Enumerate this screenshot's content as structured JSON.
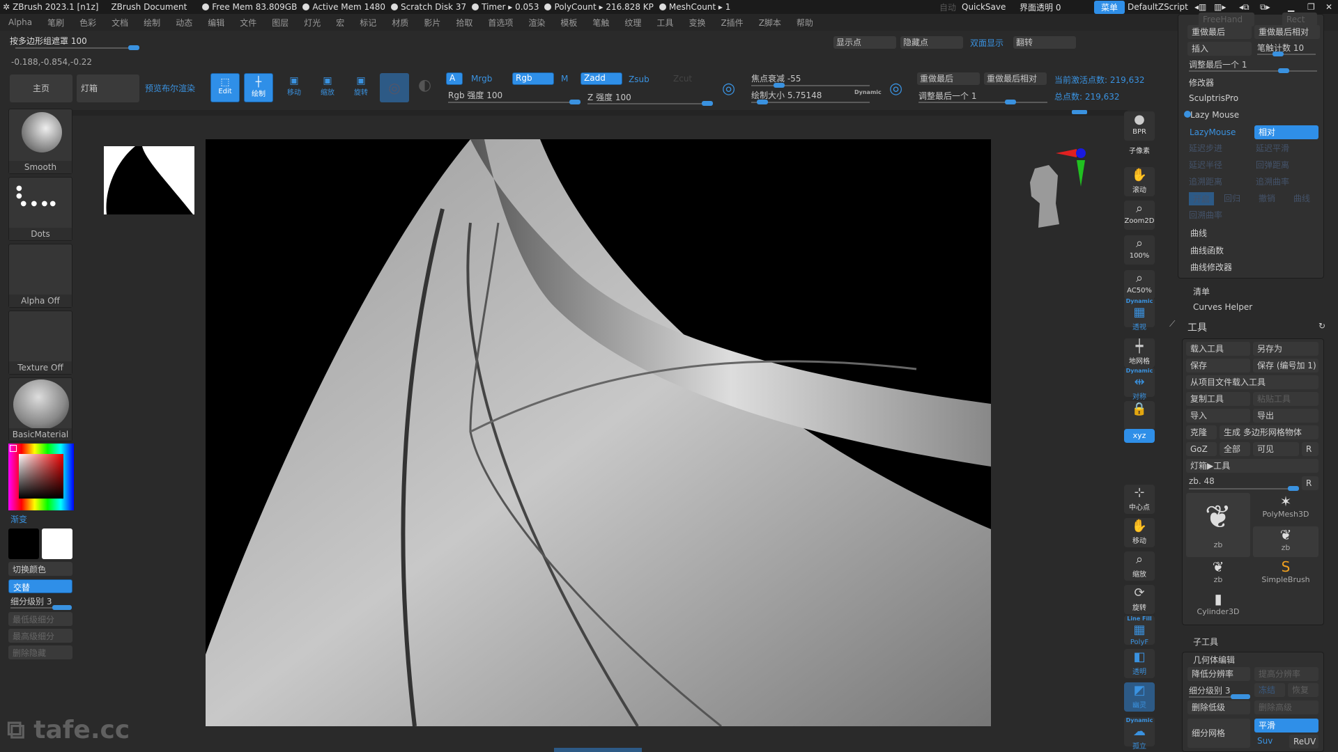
{
  "titlebar": {
    "app": "ZBrush 2023.1 [n1z]",
    "document": "ZBrush Document",
    "stats": [
      {
        "label": "Free Mem 83.809GB"
      },
      {
        "label": "Active Mem 1480"
      },
      {
        "label": "Scratch Disk 37"
      },
      {
        "label": "Timer ▸ 0.053"
      },
      {
        "label": "PolyCount ▸ 216.828 KP"
      },
      {
        "label": "MeshCount ▸ 1"
      }
    ],
    "auto": "自动",
    "quicksave": "QuickSave",
    "ui_transparency": "界面透明 0",
    "menu_button": "菜单",
    "script": "DefaultZScript"
  },
  "menubar": [
    "Alpha",
    "笔刷",
    "色彩",
    "文档",
    "绘制",
    "动态",
    "编辑",
    "文件",
    "图层",
    "灯光",
    "宏",
    "标记",
    "材质",
    "影片",
    "拾取",
    "首选项",
    "渲染",
    "模板",
    "笔触",
    "纹理",
    "工具",
    "变换",
    "Z插件",
    "Z脚本",
    "帮助"
  ],
  "top_left": {
    "polygroup_mask": "按多边形组遮罩 100",
    "coords": "-0.188,-0.854,-0.22",
    "home": "主页",
    "lightbox": "灯箱",
    "bool_preview": "预览布尔渲染"
  },
  "toolbar": {
    "edit": "Edit",
    "draw": "绘制",
    "move": "移动",
    "scale": "缩放",
    "rotate": "旋转",
    "a": "A",
    "mrgb": "Mrgb",
    "rgb": "Rgb",
    "m": "M",
    "zadd": "Zadd",
    "zsub": "Zsub",
    "zcut": "Zcut",
    "rgb_intensity": "Rgb 强度 100",
    "z_intensity": "Z 强度 100",
    "focal_shift": "焦点衰减 -55",
    "draw_size": "绘制大小 5.75148",
    "dynamic": "Dynamic",
    "redo_last": "重做最后",
    "redo_last_rel": "重做最后相对",
    "adjust_last": "调整最后一个 1",
    "active_points": "当前激活点数: 219,632",
    "total_points": "总点数: 219,632",
    "show_pts": "显示点",
    "hide_pts": "隐藏点",
    "double_sided": "双面显示",
    "flip": "翻转"
  },
  "left_panel": {
    "brush": "Smooth",
    "stroke": "Dots",
    "alpha": "Alpha Off",
    "texture": "Texture Off",
    "material": "BasicMaterial",
    "gradient": "渐变",
    "switch_color": "切换颜色",
    "alternate": "交替",
    "subdiv": "细分级别 3",
    "lowest": "最低级细分",
    "highest": "最高级细分",
    "del_hidden": "删除隐藏"
  },
  "right_toolbar": [
    {
      "icon": "bpr-icon",
      "label": "BPR"
    },
    {
      "icon": "subpixel",
      "label": "子像素"
    },
    {
      "icon": "hand-icon",
      "label": "滚动"
    },
    {
      "icon": "zoom-icon",
      "label": "Zoom2D"
    },
    {
      "icon": "zoom-icon",
      "label": "100%"
    },
    {
      "icon": "zoom-icon",
      "label": "AC50%"
    },
    {
      "icon": "perspective-icon",
      "label": "透视",
      "top": "Dynamic"
    },
    {
      "icon": "floor-icon",
      "label": "地网格"
    },
    {
      "icon": "symmetry-icon",
      "label": "对称",
      "top": "Dynamic"
    },
    {
      "icon": "lock-icon",
      "label": ""
    },
    {
      "icon": "xyz-icon",
      "label": "xyz"
    },
    {
      "icon": "center-icon",
      "label": "中心点"
    },
    {
      "icon": "move-icon",
      "label": "移动"
    },
    {
      "icon": "scale-icon",
      "label": "缩放"
    },
    {
      "icon": "rotate-icon",
      "label": "旋转"
    },
    {
      "icon": "polyf-icon",
      "label": "PolyF",
      "top": "Line Fill"
    },
    {
      "icon": "transp-icon",
      "label": "透明"
    },
    {
      "icon": "ghost-icon",
      "label": "幽灵"
    },
    {
      "icon": "solo-icon",
      "label": "孤立",
      "top": "Dynamic"
    }
  ],
  "right_panel": {
    "freehand": "FreeHand",
    "rect": "Rect",
    "redo_last": "重做最后",
    "redo_last_rel": "重做最后相对",
    "insert": "插入",
    "stroke_count": "笔触计数 10",
    "adjust_last": "调整最后一个 1",
    "modifiers": "修改器",
    "sculptris": "SculptrisPro",
    "lazy_mouse": "Lazy Mouse",
    "lazymouse_btn": "LazyMouse",
    "relative": "相对",
    "lazy_dim": [
      "延迟步进",
      "延迟平滑",
      "延迟半径",
      "回弹距离",
      "追溯距离",
      "追溯曲率",
      "开启",
      "回归",
      "撤销",
      "曲线",
      "回溯曲率"
    ],
    "curve": "曲线",
    "curve_func": "曲线函数",
    "curve_mod": "曲线修改器",
    "list": "清单",
    "curves_helper": "Curves Helper",
    "tool_title": "工具",
    "load_tool": "载入工具",
    "save_as": "另存为",
    "save": "保存",
    "save_inc": "保存 (编号加 1)",
    "load_from_project": "从项目文件载入工具",
    "copy_tool": "复制工具",
    "paste_tool": "粘贴工具",
    "import": "导入",
    "export": "导出",
    "clone": "克隆",
    "make_polymesh": "生成 多边形网格物体",
    "goz": "GoZ",
    "all": "全部",
    "visible": "可见",
    "r": "R",
    "lightbox_tool": "灯箱▶工具",
    "zb_slider": "zb. 48",
    "tools": [
      "zb",
      "PolyMesh3D",
      "zb",
      "zb",
      "SimpleBrush",
      "Cylinder3D"
    ],
    "subtool": "子工具",
    "geometry": "几何体编辑",
    "lower_res": "降低分辨率",
    "higher_res": "提高分辨率",
    "subdiv": "细分级别 3",
    "del_lower": "删除低级",
    "del_higher": "删除高级",
    "divide": "细分网格",
    "smooth": "平滑",
    "suv": "Suv",
    "reuv": "ReUV",
    "freeze": "冻结",
    "restore": "恢复"
  },
  "watermark": "tafe.cc"
}
